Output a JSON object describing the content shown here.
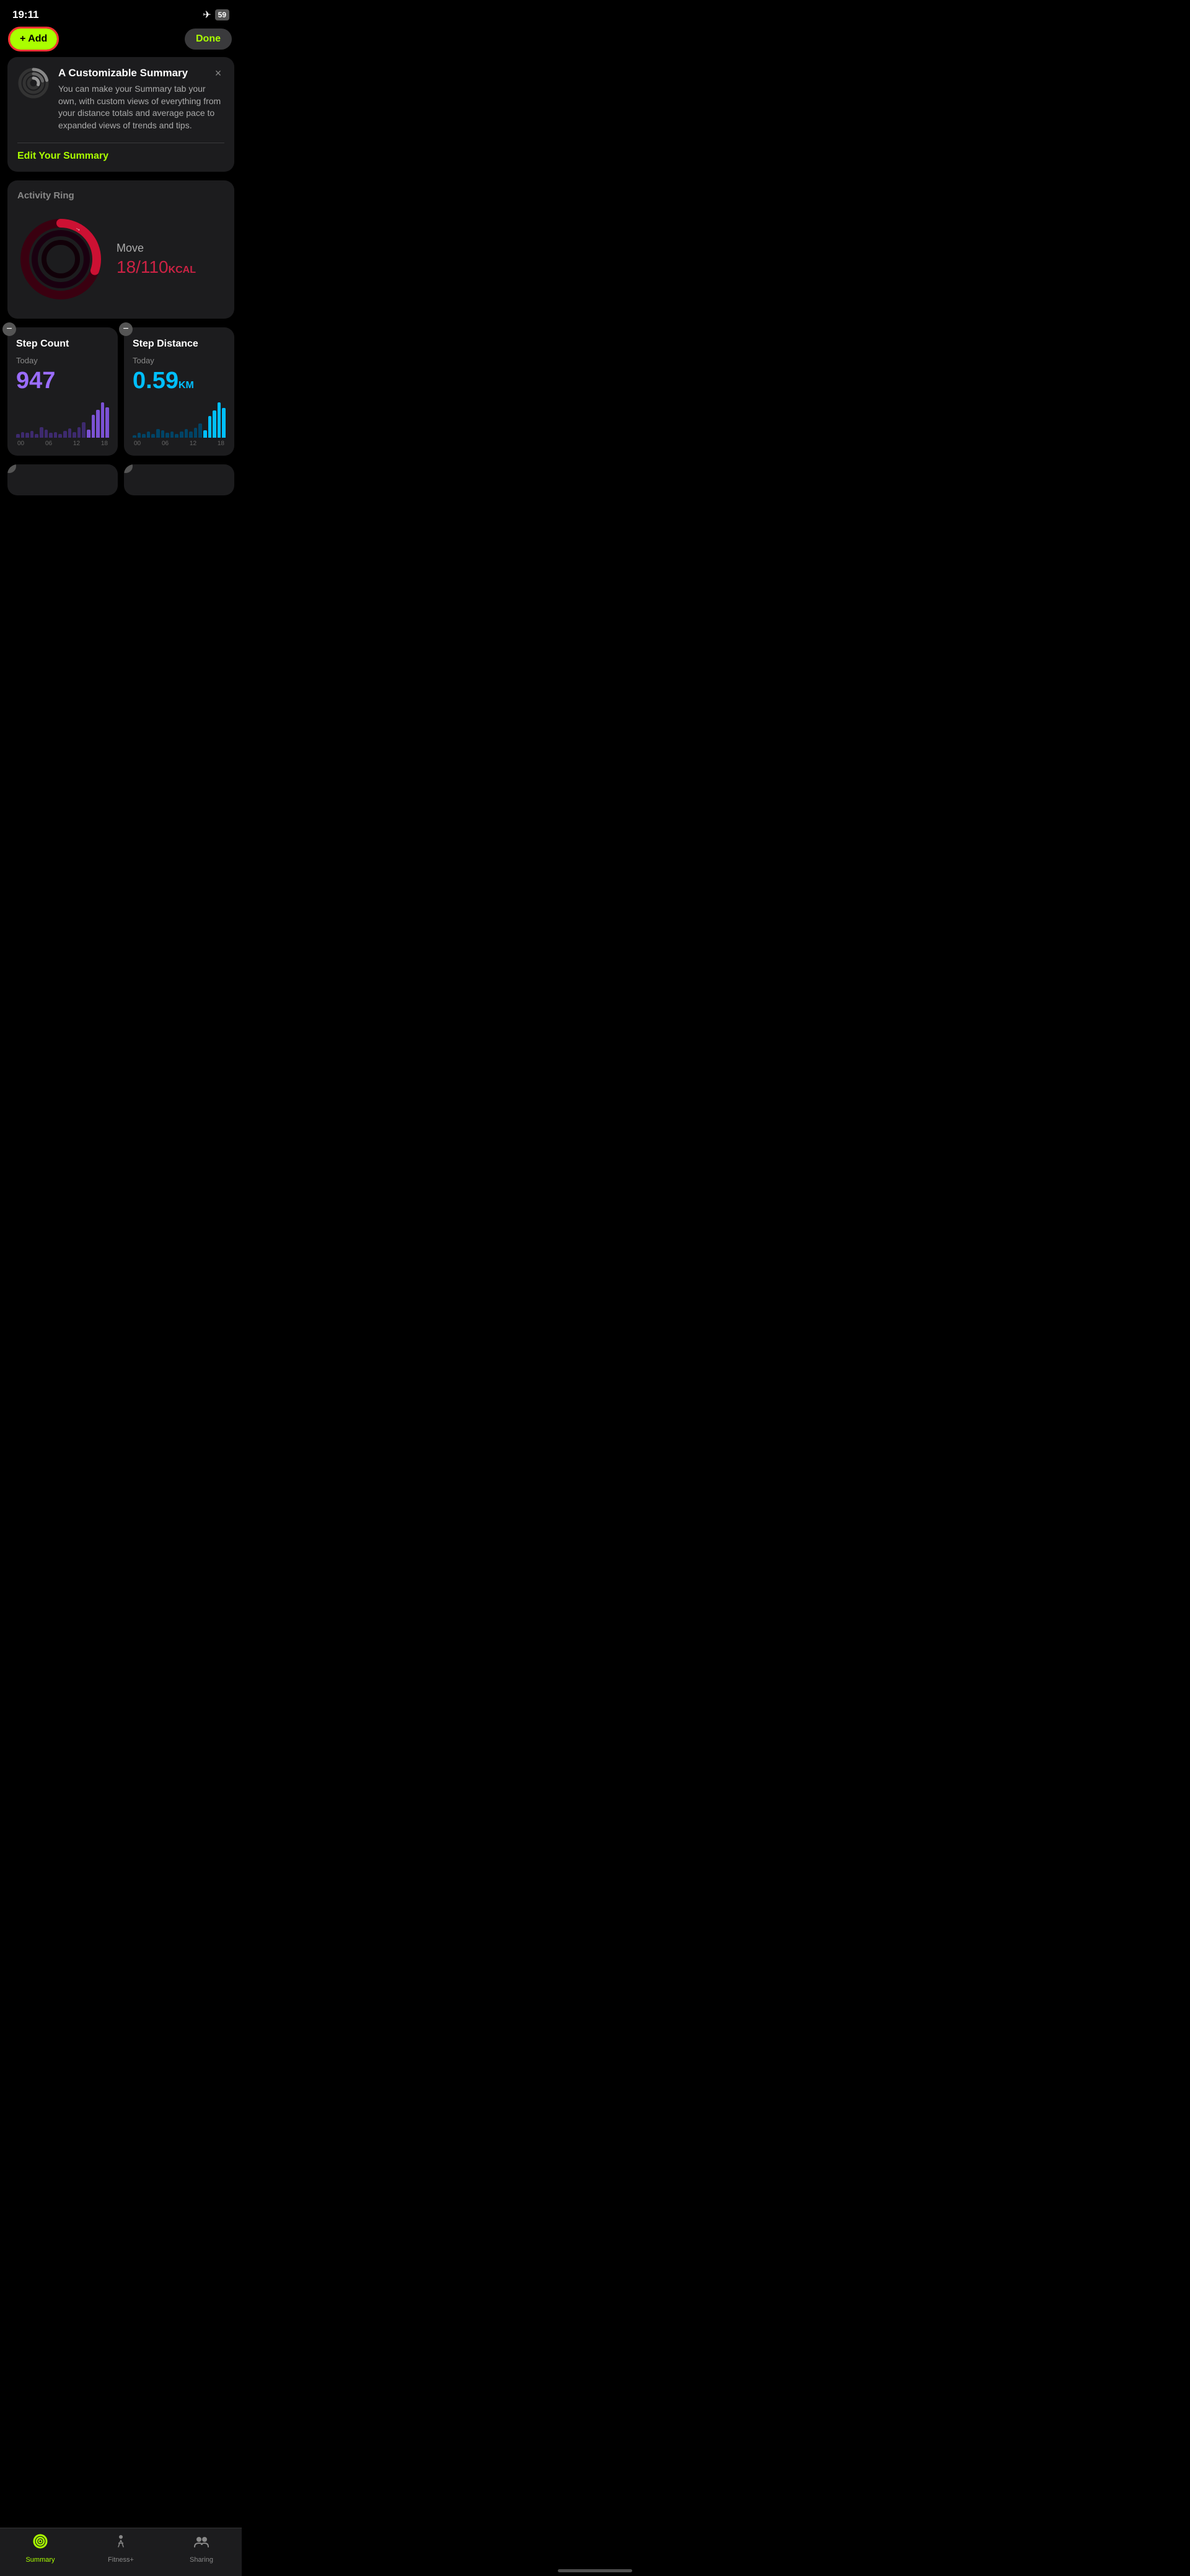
{
  "statusBar": {
    "time": "19:11",
    "battery": "59",
    "batteryIcon": "🛩"
  },
  "topActions": {
    "addButton": "+ Add",
    "doneButton": "Done"
  },
  "customizableCard": {
    "title": "A Customizable Summary",
    "description": "You can make your Summary tab your own, with custom views of everything from your distance totals and average pace to expanded views of trends and tips.",
    "editLink": "Edit Your Summary",
    "closeIcon": "×"
  },
  "activityRingCard": {
    "title": "Activity Ring",
    "moveLabel": "Move",
    "moveValue": "18/110",
    "moveUnit": "KCAL"
  },
  "stepCountWidget": {
    "title": "Step Count",
    "minusIcon": "−",
    "period": "Today",
    "value": "947",
    "chartBars": [
      2,
      4,
      3,
      5,
      2,
      8,
      6,
      3,
      4,
      2,
      5,
      7,
      4,
      8,
      12,
      6,
      18,
      22,
      28,
      24
    ],
    "chartLabels": [
      "00",
      "06",
      "12",
      "18"
    ]
  },
  "stepDistanceWidget": {
    "title": "Step Distance",
    "minusIcon": "−",
    "period": "Today",
    "value": "0.59",
    "unit": "KM",
    "chartBars": [
      1,
      3,
      2,
      4,
      2,
      6,
      5,
      3,
      4,
      2,
      4,
      6,
      4,
      7,
      10,
      5,
      16,
      20,
      26,
      22
    ],
    "chartLabels": [
      "00",
      "06",
      "12",
      "18"
    ]
  },
  "tabBar": {
    "tabs": [
      {
        "id": "summary",
        "label": "Summary",
        "icon": "○",
        "active": true
      },
      {
        "id": "fitness",
        "label": "Fitness+",
        "icon": "🏃",
        "active": false
      },
      {
        "id": "sharing",
        "label": "Sharing",
        "icon": "👥",
        "active": false
      }
    ]
  }
}
